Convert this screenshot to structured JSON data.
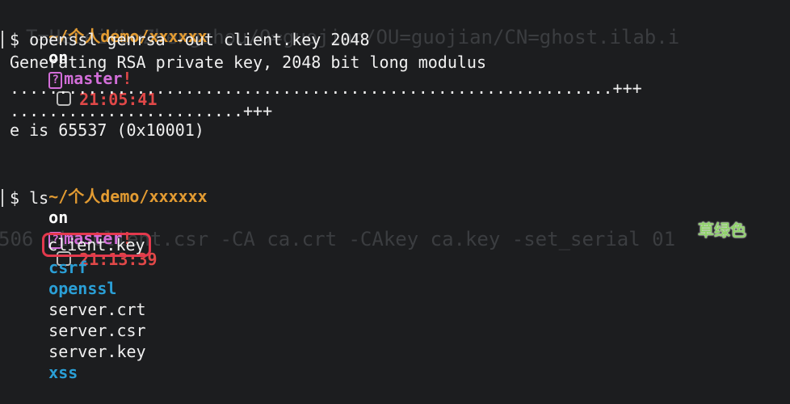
{
  "ghost_lines": [
    "T=Hebei/L=Zhengzhou/O=guojian/OU=guojian/CN=ghost.ilab.i",
    "506 -in client.csr -CA ca.crt -CAkey ca.key -set_serial 01"
  ],
  "prompt1": {
    "cwd": "~/个人demo/xxxxxx",
    "on": "on",
    "branch_icon": "?",
    "branch": "master",
    "dirty": "!",
    "time": "21:05:41"
  },
  "command1": "$ openssl genrsa -out client.key 2048",
  "output1": [
    "Generating RSA private key, 2048 bit long modulus",
    "..............................................................+++",
    "........................+++",
    "e is 65537 (0x10001)"
  ],
  "prompt2": {
    "cwd": "~/个人demo/xxxxxx",
    "on": "on",
    "branch_icon": "?",
    "branch": "master",
    "dirty": "!",
    "time": "21:13:39"
  },
  "command2": "$ ls",
  "files": [
    {
      "name": "client.key",
      "kind": "file"
    },
    {
      "name": "csrf",
      "kind": "dir"
    },
    {
      "name": "openssl",
      "kind": "dir"
    },
    {
      "name": "server.crt",
      "kind": "file"
    },
    {
      "name": "server.csr",
      "kind": "file"
    },
    {
      "name": "server.key",
      "kind": "file"
    },
    {
      "name": "xss",
      "kind": "dir"
    }
  ],
  "caption": "草绿色",
  "colors": {
    "background": "#1c1d1f",
    "cwd": "#e29b32",
    "branch": "#d26ed8",
    "time": "#e04848",
    "directory": "#2a9fd6",
    "highlight_box": "#e3394d",
    "caption": "#8fd16a"
  }
}
